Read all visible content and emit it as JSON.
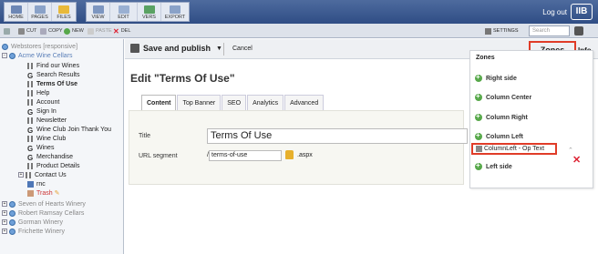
{
  "topbar": {
    "buttons": [
      {
        "label": "HOME",
        "icon": "home-icon",
        "color": "#6d87b5"
      },
      {
        "label": "PAGES",
        "icon": "pages-icon",
        "color": "#8aa2c8"
      },
      {
        "label": "FILES",
        "icon": "files-icon",
        "color": "#e8b93a"
      },
      {
        "label": "VIEW",
        "icon": "view-icon",
        "color": "#7d96c0"
      },
      {
        "label": "EDIT",
        "icon": "edit-icon",
        "color": "#9ab0d2"
      },
      {
        "label": "VERS",
        "icon": "versions-icon",
        "color": "#5aa263"
      },
      {
        "label": "EXPORT",
        "icon": "export-icon",
        "color": "#8aa2c8"
      }
    ],
    "logout": "Log out",
    "logo": "IIB"
  },
  "toolbar2": {
    "cut": "CUT",
    "copy": "COPY",
    "new": "NEW",
    "paste": "PASTE",
    "del": "DEL",
    "settings": "SETTINGS",
    "search_placeholder": "Search"
  },
  "tree": {
    "root": "Webstores [responsive]",
    "site": "Acme Wine Cellars",
    "items": [
      {
        "label": "Find our Wines",
        "icon": "page"
      },
      {
        "label": "Search Results",
        "icon": "g"
      },
      {
        "label": "Terms Of Use",
        "icon": "page",
        "selected": true
      },
      {
        "label": "Help",
        "icon": "page"
      },
      {
        "label": "Account",
        "icon": "page"
      },
      {
        "label": "Sign In",
        "icon": "g"
      },
      {
        "label": "Newsletter",
        "icon": "page"
      },
      {
        "label": "Wine Club Join Thank You",
        "icon": "g"
      },
      {
        "label": "Wine Club",
        "icon": "page"
      },
      {
        "label": "Wines",
        "icon": "g"
      },
      {
        "label": "Merchandise",
        "icon": "g"
      },
      {
        "label": "Product Details",
        "icon": "page"
      },
      {
        "label": "Contact Us",
        "icon": "page"
      },
      {
        "label": "rnc",
        "icon": "folder"
      },
      {
        "label": "Trash",
        "icon": "trash"
      }
    ],
    "other_sites": [
      "Seven of Hearts Winery",
      "Robert Ramsay Cellars",
      "Gorman Winery",
      "Frichette Winery"
    ]
  },
  "actions": {
    "save": "Save and publish",
    "cancel": "Cancel",
    "zones": "Zones",
    "info": "Info"
  },
  "editor": {
    "title": "Edit \"Terms Of Use\"",
    "tabs": [
      "Content",
      "Top Banner",
      "SEO",
      "Analytics",
      "Advanced"
    ],
    "active_tab": "Content",
    "title_label": "Title",
    "title_value": "Terms Of Use",
    "url_label": "URL segment",
    "url_prefix": "/",
    "url_value": "terms-of-use",
    "url_suffix": ".aspx"
  },
  "zones": {
    "header": "Zones",
    "items": [
      "Right side",
      "Column Center",
      "Column Right",
      "Column Left"
    ],
    "highlighted": "ColumnLeft - Op Text",
    "after": "Left side"
  },
  "colors": {
    "highlight": "#e03c28",
    "zone_add": "#57a84a",
    "topbar": "#2f4d85"
  }
}
